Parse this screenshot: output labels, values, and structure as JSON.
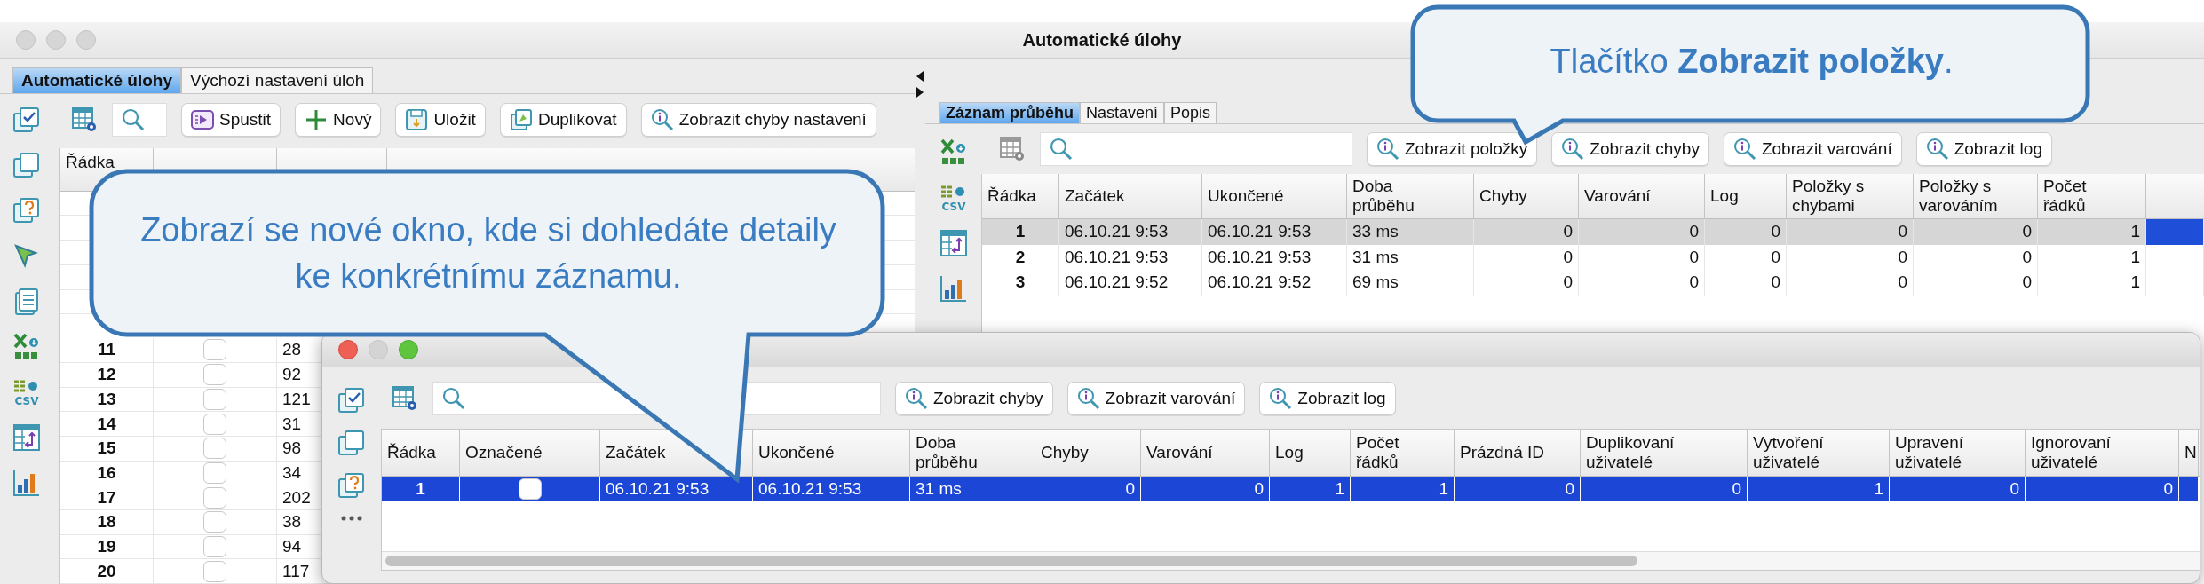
{
  "window": {
    "title": "Automatické úlohy"
  },
  "left_tabs": [
    {
      "label": "Automatické úlohy",
      "selected": true
    },
    {
      "label": "Výchozí nastavení úloh",
      "selected": false
    }
  ],
  "left_sidebar": [
    {
      "kind": "checked-windows"
    },
    {
      "kind": "windows"
    },
    {
      "kind": "help-windows"
    },
    {
      "kind": "pointer"
    },
    {
      "kind": "document"
    },
    {
      "kind": "excel"
    },
    {
      "kind": "csv",
      "label": "CSV"
    },
    {
      "kind": "table-swap"
    },
    {
      "kind": "chart"
    }
  ],
  "left_toolbar": {
    "buttons": [
      {
        "label": "Spustit",
        "kind": "run"
      },
      {
        "label": "Nový",
        "kind": "new"
      },
      {
        "label": "Uložit",
        "kind": "save"
      },
      {
        "label": "Duplikovat",
        "kind": "duplicate"
      },
      {
        "label": "Zobrazit chyby nastavení",
        "kind": "info"
      }
    ]
  },
  "left_table": {
    "columns": [
      "Řádka"
    ],
    "rows": [
      {
        "row": "11",
        "checked": false,
        "id": "28"
      },
      {
        "row": "12",
        "checked": false,
        "id": "92"
      },
      {
        "row": "13",
        "checked": false,
        "id": "121"
      },
      {
        "row": "14",
        "checked": false,
        "id": "31"
      },
      {
        "row": "15",
        "checked": false,
        "id": "98"
      },
      {
        "row": "16",
        "checked": false,
        "id": "34"
      },
      {
        "row": "17",
        "checked": false,
        "id": "202"
      },
      {
        "row": "18",
        "checked": false,
        "id": "38"
      },
      {
        "row": "19",
        "checked": false,
        "id": "94"
      },
      {
        "row": "20",
        "checked": false,
        "id": "117"
      }
    ]
  },
  "right_tabs": [
    {
      "label": "Záznam průběhu",
      "selected": true
    },
    {
      "label": "Nastavení",
      "selected": false
    },
    {
      "label": "Popis",
      "selected": false
    }
  ],
  "right_sidebar": [
    {
      "kind": "excel"
    },
    {
      "kind": "csv",
      "label": "CSV"
    },
    {
      "kind": "table-swap"
    },
    {
      "kind": "chart"
    }
  ],
  "right_toolbar": {
    "buttons": [
      "Zobrazit položky",
      "Zobrazit chyby",
      "Zobrazit varování",
      "Zobrazit log"
    ]
  },
  "right_table": {
    "columns": [
      {
        "label": "Řádka",
        "kind": "index"
      },
      {
        "label": "Začátek",
        "kind": "text"
      },
      {
        "label": "Ukončené",
        "kind": "text"
      },
      {
        "label": "Doba průběhu",
        "kind": "text"
      },
      {
        "label": "Chyby",
        "kind": "number"
      },
      {
        "label": "Varování",
        "kind": "number"
      },
      {
        "label": "Log",
        "kind": "number"
      },
      {
        "label": "Položky s chybami",
        "kind": "number"
      },
      {
        "label": "Položky s varováním",
        "kind": "number"
      },
      {
        "label": "Počet řádků",
        "kind": "number"
      }
    ],
    "rows": [
      {
        "selected": true,
        "cells": [
          "1",
          "06.10.21 9:53",
          "06.10.21 9:53",
          "33 ms",
          "0",
          "0",
          "0",
          "0",
          "0",
          "1"
        ]
      },
      {
        "selected": false,
        "cells": [
          "2",
          "06.10.21 9:53",
          "06.10.21 9:53",
          "31 ms",
          "0",
          "0",
          "0",
          "0",
          "0",
          "1"
        ]
      },
      {
        "selected": false,
        "cells": [
          "3",
          "06.10.21 9:52",
          "06.10.21 9:52",
          "69 ms",
          "0",
          "0",
          "0",
          "0",
          "0",
          "1"
        ]
      }
    ]
  },
  "popup_window": {
    "sidebar": [
      {
        "kind": "checked-windows"
      },
      {
        "kind": "windows"
      },
      {
        "kind": "help-windows"
      },
      {
        "kind": "more"
      }
    ],
    "toolbar_buttons": [
      "Zobrazit chyby",
      "Zobrazit varování",
      "Zobrazit log"
    ],
    "table": {
      "columns": [
        {
          "label": "Řádka",
          "kind": "index"
        },
        {
          "label": "Označené",
          "kind": "check"
        },
        {
          "label": "Začátek",
          "kind": "text"
        },
        {
          "label": "Ukončené",
          "kind": "text"
        },
        {
          "label": "Doba průběhu",
          "kind": "text"
        },
        {
          "label": "Chyby",
          "kind": "number"
        },
        {
          "label": "Varování",
          "kind": "number"
        },
        {
          "label": "Log",
          "kind": "number"
        },
        {
          "label": "Počet řádků",
          "kind": "number"
        },
        {
          "label": "Prázdná ID",
          "kind": "number"
        },
        {
          "label": "Duplikovaní uživatelé",
          "kind": "number"
        },
        {
          "label": "Vytvoření uživatelé",
          "kind": "number"
        },
        {
          "label": "Upravení uživatelé",
          "kind": "number"
        },
        {
          "label": "Ignorovaní uživatelé",
          "kind": "number"
        },
        {
          "label": "N",
          "kind": "text"
        }
      ],
      "rows": [
        {
          "selected": true,
          "checked": false,
          "cells": [
            "1",
            "",
            "06.10.21 9:53",
            "06.10.21 9:53",
            "31 ms",
            "0",
            "0",
            "1",
            "1",
            "0",
            "0",
            "1",
            "0",
            "0"
          ]
        }
      ]
    }
  },
  "callouts": [
    {
      "text": "Zobrazí se nové okno, kde si dohledáte detaily ke konkrétnímu záznamu."
    },
    {
      "text": "Tlačítko **Zobrazit položky**."
    }
  ]
}
